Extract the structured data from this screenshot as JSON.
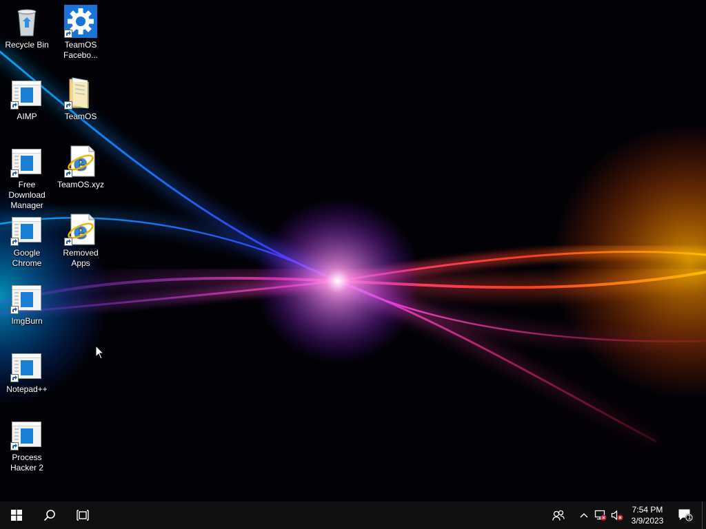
{
  "desktop": {
    "icons": [
      {
        "label": "Recycle Bin",
        "icon": "recycle-bin-icon"
      },
      {
        "label": "TeamOS Facebo...",
        "icon": "settings-gear-icon"
      },
      {
        "label": "AIMP",
        "icon": "generic-app-icon"
      },
      {
        "label": "TeamOS",
        "icon": "folder-icon"
      },
      {
        "label": "Free Download Manager",
        "icon": "generic-app-icon"
      },
      {
        "label": "TeamOS.xyz",
        "icon": "internet-explorer-icon"
      },
      {
        "label": "Google Chrome",
        "icon": "generic-app-icon"
      },
      {
        "label": "Removed Apps",
        "icon": "internet-explorer-icon"
      },
      {
        "label": "ImgBurn",
        "icon": "generic-app-icon"
      },
      {
        "label": "Notepad++",
        "icon": "generic-app-icon"
      },
      {
        "label": "Process Hacker 2",
        "icon": "generic-app-icon"
      }
    ]
  },
  "taskbar": {
    "clock": {
      "time": "7:54 PM",
      "date": "3/9/2023"
    },
    "notification_count": "1",
    "icons": {
      "start": "windows-logo-icon",
      "search": "search-icon",
      "task_view": "task-view-icon",
      "people": "people-icon",
      "tray_overflow": "chevron-up-icon",
      "network": "network-disconnected-icon",
      "volume": "volume-muted-icon",
      "action_center": "action-center-icon"
    }
  },
  "colors": {
    "taskbar": "#101010",
    "accent_blue": "#1c7fd6",
    "error_red": "#e81123"
  }
}
